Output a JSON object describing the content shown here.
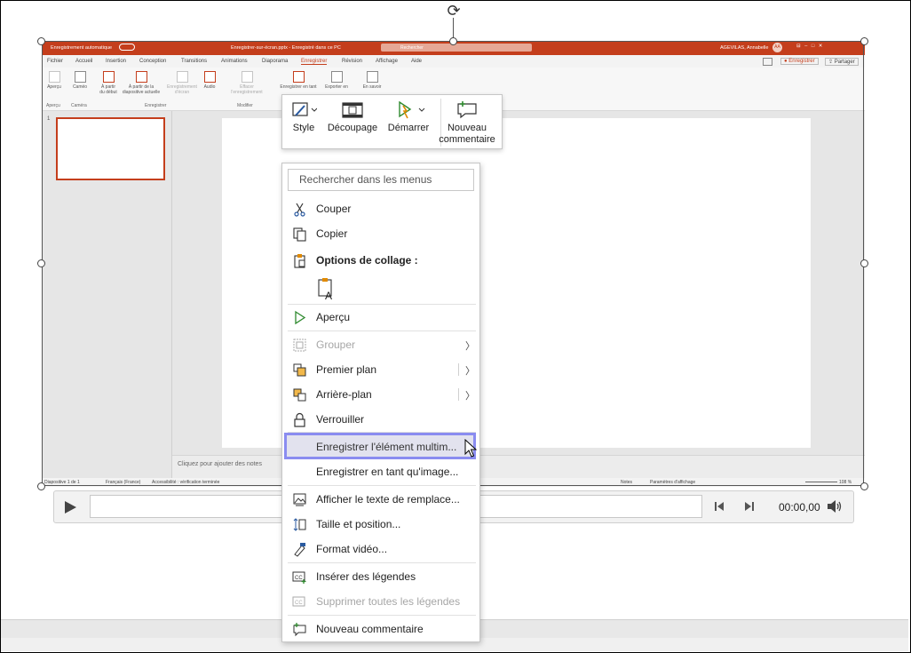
{
  "ppt": {
    "title_left": "Enregistrement automatique",
    "filename": "Enregistrer-sur-écran.pptx - Enregistré dans ce PC",
    "search": "Rechercher",
    "user": "AGEVILAS, Annabelle",
    "user_initials": "AA",
    "tabs": [
      "Fichier",
      "Accueil",
      "Insertion",
      "Conception",
      "Transitions",
      "Animations",
      "Diaporama",
      "Enregistrer",
      "Révision",
      "Affichage",
      "Aide"
    ],
    "active_tab": "Enregistrer",
    "enregistrer_btn": "Enregistrer",
    "partager_btn": "Partager",
    "ribbon": {
      "apercu": "Aperçu",
      "camera": "Caméo",
      "debut1": "À partir",
      "debut2": "du début",
      "diapo1": "À partir de la",
      "diapo2": "diapositive actuelle",
      "ecran1": "Enregistrement",
      "ecran2": "d'écran",
      "audio": "Audio",
      "effacer1": "Effacer",
      "effacer2": "l'enregistrement",
      "enr_tant": "Enregistrer en tant",
      "export": "Exporter en",
      "savoir": "En savoir",
      "groups": [
        "Aperçu",
        "Caméra",
        "Enregistrer",
        "Modifier"
      ]
    },
    "slide_number": "1",
    "notes_placeholder": "Cliquez pour ajouter des notes",
    "status": {
      "slide": "Diapositive 1 de 1",
      "lang": "Français (France)",
      "access": "Accessibilité : vérification terminée",
      "notes": "Notes",
      "display": "Paramètres d'affichage",
      "zoom": "108 %"
    }
  },
  "player": {
    "time": "00:00,00"
  },
  "mini_toolbar": {
    "style": "Style",
    "crop": "Découpage",
    "start": "Démarrer",
    "new_comment_1": "Nouveau",
    "new_comment_2": "commentaire"
  },
  "menu": {
    "search_placeholder": "Rechercher dans les menus",
    "cut": "Couper",
    "copy": "Copier",
    "paste_options": "Options de collage :",
    "preview": "Aperçu",
    "group": "Grouper",
    "bring_front": "Premier plan",
    "send_back": "Arrière-plan",
    "lock": "Verrouiller",
    "save_media": "Enregistrer l'élément multim...",
    "save_as_image": "Enregistrer en tant qu'image...",
    "alt_text": "Afficher le texte de remplace...",
    "size_position": "Taille et position...",
    "format_video": "Format vidéo...",
    "insert_captions": "Insérer des légendes",
    "remove_captions": "Supprimer toutes les légendes",
    "new_comment": "Nouveau commentaire"
  },
  "colors": {
    "ppt_accent": "#c43e1c",
    "highlight_border": "#8a8cf0"
  }
}
